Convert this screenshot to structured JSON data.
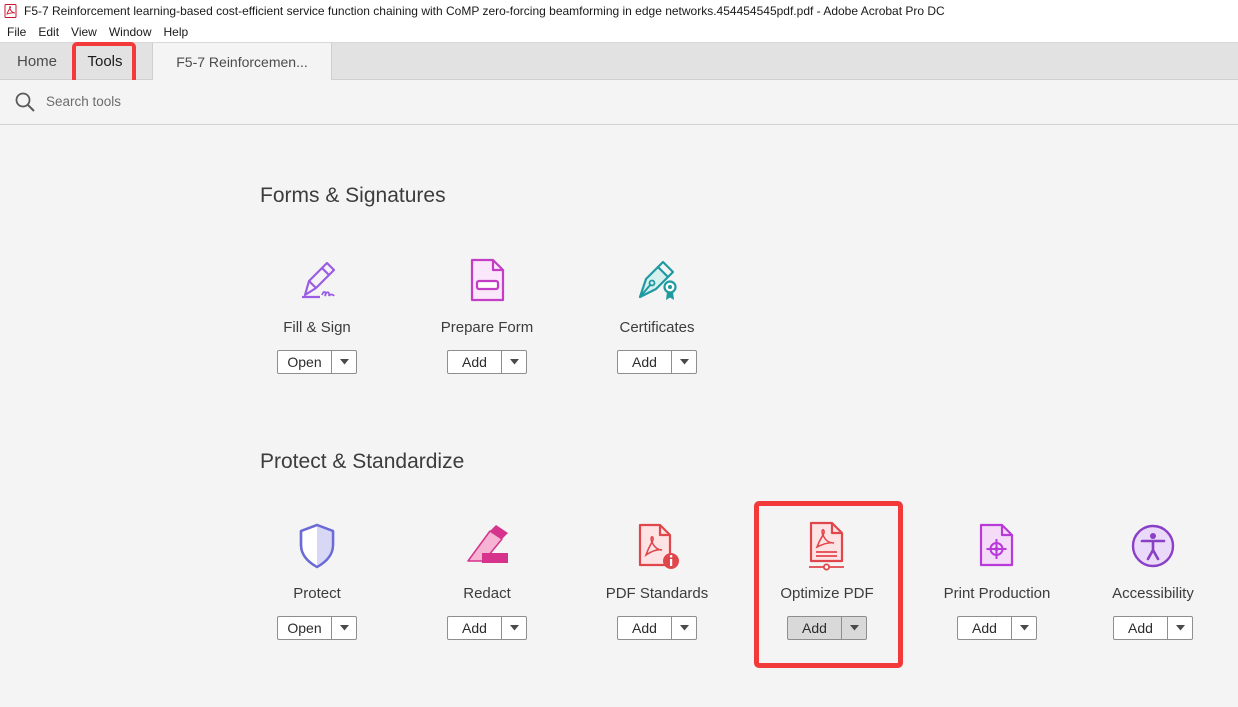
{
  "window": {
    "title": "F5-7 Reinforcement learning-based cost-efficient service function chaining with CoMP zero-forcing beamforming in edge networks.454454545pdf.pdf - Adobe Acrobat Pro DC"
  },
  "menu": [
    "File",
    "Edit",
    "View",
    "Window",
    "Help"
  ],
  "tabs": {
    "home": "Home",
    "tools": "Tools",
    "document": "F5-7 Reinforcemen..."
  },
  "search": {
    "placeholder": "Search tools"
  },
  "sections": [
    {
      "title": "Forms & Signatures",
      "tools": [
        {
          "label": "Fill & Sign",
          "button": "Open",
          "icon": "fill-sign-icon"
        },
        {
          "label": "Prepare Form",
          "button": "Add",
          "icon": "prepare-form-icon"
        },
        {
          "label": "Certificates",
          "button": "Add",
          "icon": "certificates-icon"
        }
      ]
    },
    {
      "title": "Protect & Standardize",
      "tools": [
        {
          "label": "Protect",
          "button": "Open",
          "icon": "protect-icon"
        },
        {
          "label": "Redact",
          "button": "Add",
          "icon": "redact-icon"
        },
        {
          "label": "PDF Standards",
          "button": "Add",
          "icon": "pdf-standards-icon"
        },
        {
          "label": "Optimize PDF",
          "button": "Add",
          "icon": "optimize-pdf-icon"
        },
        {
          "label": "Print Production",
          "button": "Add",
          "icon": "print-production-icon"
        },
        {
          "label": "Accessibility",
          "button": "Add",
          "icon": "accessibility-icon"
        }
      ]
    }
  ],
  "colors": {
    "highlight": "#f23a3a",
    "fill_sign": "#9b5de5",
    "prepare_form": "#c23ec4",
    "certificates": "#1f9aa1",
    "protect": "#6b6bd6",
    "redact": "#d6338c",
    "pdf_standards": "#e0474c",
    "optimize": "#e0474c",
    "print_production": "#b93ad8",
    "accessibility": "#8a3fc7"
  }
}
